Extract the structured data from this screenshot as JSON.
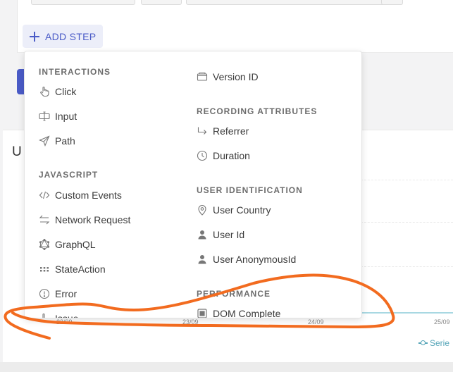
{
  "toolbar": {
    "add_step_label": "ADD STEP"
  },
  "dropdown": {
    "left": [
      {
        "title": "INTERACTIONS",
        "items": [
          {
            "label": "Click",
            "icon": "pointer-icon"
          },
          {
            "label": "Input",
            "icon": "input-cursor-icon"
          },
          {
            "label": "Path",
            "icon": "send-icon"
          }
        ]
      },
      {
        "title": "JAVASCRIPT",
        "items": [
          {
            "label": "Custom Events",
            "icon": "code-icon"
          },
          {
            "label": "Network Request",
            "icon": "arrows-exchange-icon"
          },
          {
            "label": "GraphQL",
            "icon": "graphql-icon"
          },
          {
            "label": "StateAction",
            "icon": "grid-dots-icon"
          },
          {
            "label": "Error",
            "icon": "error-circle-icon"
          },
          {
            "label": "Issue",
            "icon": "pointer-icon"
          }
        ]
      }
    ],
    "right": [
      {
        "title": "",
        "items": [
          {
            "label": "Version ID",
            "icon": "folder-icon"
          }
        ]
      },
      {
        "title": "RECORDING ATTRIBUTES",
        "items": [
          {
            "label": "Referrer",
            "icon": "arrow-turn-icon"
          },
          {
            "label": "Duration",
            "icon": "clock-icon"
          }
        ]
      },
      {
        "title": "USER IDENTIFICATION",
        "items": [
          {
            "label": "User Country",
            "icon": "map-pin-icon"
          },
          {
            "label": "User Id",
            "icon": "user-icon"
          },
          {
            "label": "User AnonymousId",
            "icon": "user-icon"
          }
        ]
      },
      {
        "title": "PERFORMANCE",
        "items": [
          {
            "label": "DOM Complete",
            "icon": "square-icon"
          }
        ]
      }
    ]
  },
  "chart": {
    "heading_initial": "U",
    "x_ticks": [
      "22/09",
      "23/09",
      "24/09",
      "25/09"
    ],
    "legend_label": "Serie"
  },
  "colors": {
    "accent": "#4a5bc7",
    "annotation": "#f26b1f",
    "series": "#55a5b8"
  }
}
